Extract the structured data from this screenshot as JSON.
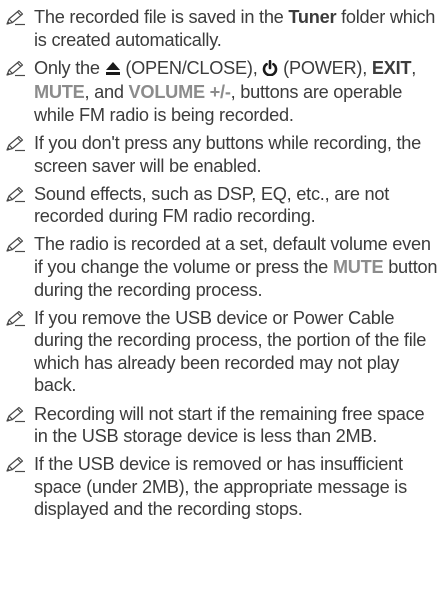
{
  "notes": [
    {
      "before": "The recorded file is saved in the ",
      "bold": "Tuner",
      "after": " folder which is created automatically."
    },
    {
      "t1": "Only the ",
      "eject_icon": "eject-icon",
      "t2": " (OPEN/CLOSE), ",
      "power_icon": "power-icon",
      "t3": " (POWER), ",
      "exit": "EXIT",
      "t4": ",",
      "mute": "MUTE",
      "t5": ", and ",
      "volume": "VOLUME +/-",
      "t6": ", buttons are operable while FM radio is being recorded."
    },
    {
      "text": "If you don't press any buttons while recording, the screen saver will be enabled."
    },
    {
      "text": "Sound effects, such as DSP, EQ, etc., are not recorded during FM radio recording."
    },
    {
      "before": "The radio is recorded at a set, default volume even if you change the volume or press the ",
      "mute": "MUTE",
      "after": " button during the recording process."
    },
    {
      "text": "If you remove the USB device or Power Cable during the recording process, the portion of the file which has already been recorded may not play back."
    },
    {
      "text": "Recording will not start if the remaining free space in the USB storage device is less than 2MB."
    },
    {
      "text": "If the USB device is removed or has insufficient space (under 2MB), the appropriate message is displayed and the recording stops."
    }
  ],
  "colors": {
    "body_text": "#3c3c3c",
    "accent_text": "#8c8c8c",
    "icon": "#4a4a4a"
  },
  "icons": {
    "note": "note-pencil-icon"
  }
}
